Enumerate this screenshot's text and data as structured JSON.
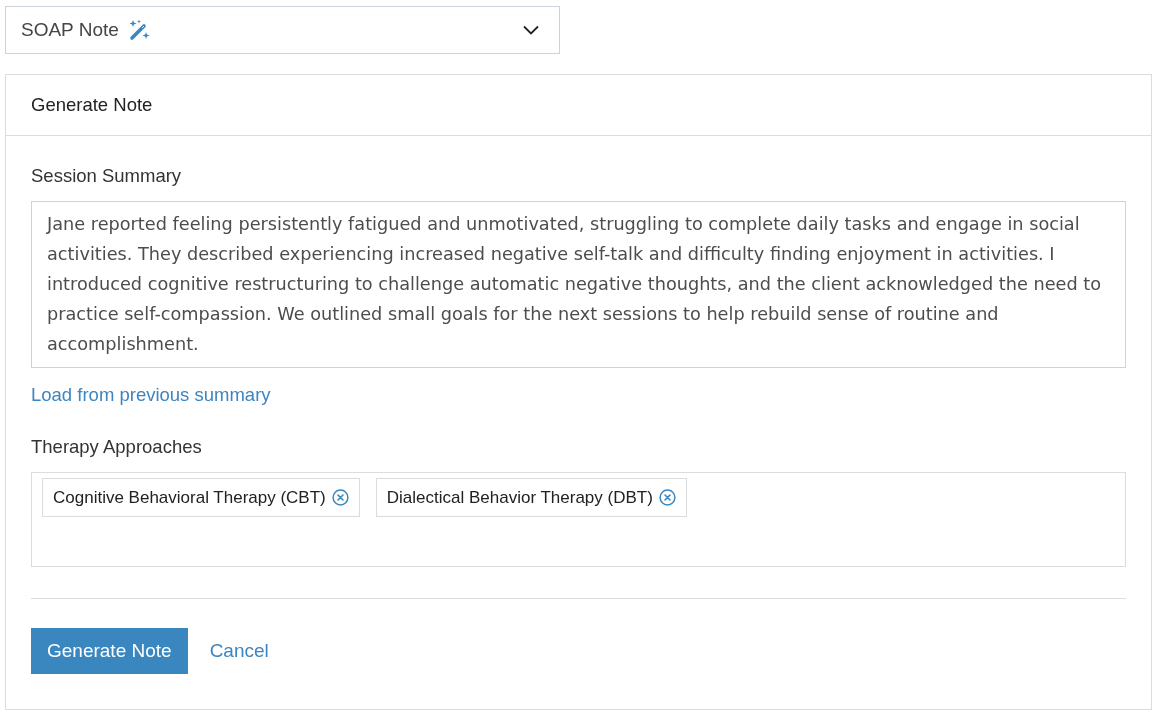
{
  "note_type_select": {
    "value": "SOAP Note"
  },
  "card": {
    "title": "Generate Note"
  },
  "session_summary": {
    "label": "Session Summary",
    "value": "Jane reported feeling persistently fatigued and unmotivated, struggling to complete daily tasks and engage in social activities. They described experiencing increased negative self-talk and difficulty finding enjoyment in activities. I introduced cognitive restructuring to challenge automatic negative thoughts, and the client acknowledged the need to practice self-compassion. We outlined small goals for the next sessions to help rebuild sense of routine and accomplishment."
  },
  "load_link": "Load from previous summary",
  "therapy_approaches": {
    "label": "Therapy Approaches",
    "tags": [
      {
        "label": "Cognitive Behavioral Therapy (CBT)"
      },
      {
        "label": "Dialectical Behavior Therapy (DBT)"
      }
    ]
  },
  "buttons": [
    {
      "label": "Generate Note",
      "kind": "primary"
    },
    {
      "label": "Cancel",
      "kind": "link"
    }
  ]
}
